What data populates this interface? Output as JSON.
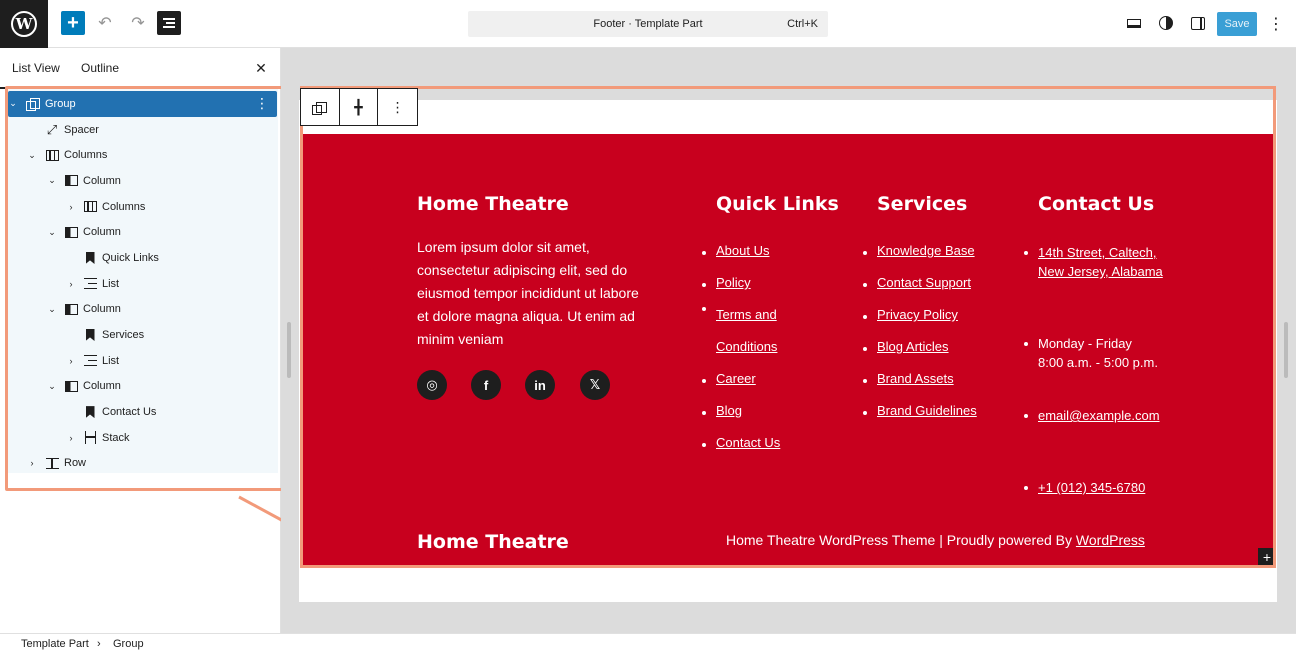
{
  "topbar": {
    "document_title": "Footer · Template Part",
    "shortcut": "Ctrl+K",
    "save_label": "Save"
  },
  "sidebar": {
    "tabs": [
      {
        "label": "List View"
      },
      {
        "label": "Outline"
      }
    ]
  },
  "tree": [
    {
      "label": "Group",
      "icon": "group-icon",
      "selected": true
    },
    {
      "label": "Spacer",
      "icon": "spacer-icon"
    },
    {
      "label": "Columns",
      "icon": "columns-icon"
    },
    {
      "label": "Column",
      "icon": "column-icon"
    },
    {
      "label": "Columns",
      "icon": "columns-icon"
    },
    {
      "label": "Column",
      "icon": "column-icon"
    },
    {
      "label": "Quick Links",
      "icon": "heading-icon"
    },
    {
      "label": "List",
      "icon": "list-icon"
    },
    {
      "label": "Column",
      "icon": "column-icon"
    },
    {
      "label": "Services",
      "icon": "heading-icon"
    },
    {
      "label": "List",
      "icon": "list-icon"
    },
    {
      "label": "Column",
      "icon": "column-icon"
    },
    {
      "label": "Contact Us",
      "icon": "heading-icon"
    },
    {
      "label": "Stack",
      "icon": "stack-icon"
    },
    {
      "label": "Row",
      "icon": "row-icon"
    }
  ],
  "footer": {
    "brand_title": "Home Theatre",
    "about_text": "Lorem ipsum dolor sit amet, consectetur adipiscing elit, sed do eiusmod tempor incididunt ut labore et dolore magna aliqua. Ut enim ad minim veniam",
    "social_icons": [
      "instagram-icon",
      "facebook-icon",
      "linkedin-icon",
      "x-icon"
    ],
    "quick_links_title": "Quick Links",
    "quick_links": [
      "About Us",
      "Policy",
      "Terms and Conditions",
      "Career",
      "Blog",
      "Contact Us"
    ],
    "services_title": "Services",
    "services": [
      "Knowledge Base",
      "Contact Support",
      "Privacy Policy",
      "Blog Articles",
      "Brand Assets",
      "Brand Guidelines"
    ],
    "contact_title": "Contact Us",
    "contact": {
      "address": "14th Street, Caltech, New Jersey, Alabama",
      "hours_days": "Monday - Friday",
      "hours_time": "8:00 a.m. - 5:00 p.m.",
      "email": "email@example.com",
      "phone": "+1 (012) 345-6780"
    },
    "bottom_title": "Home Theatre",
    "copyright_text": "Home Theatre WordPress Theme | Proudly powered By ",
    "copyright_link": "WordPress"
  },
  "breadcrumb": [
    "Template Part",
    "Group"
  ],
  "colors": {
    "footer_bg": "#c8001e",
    "selection_highlight": "#f29a7a",
    "accent": "#007cba"
  }
}
